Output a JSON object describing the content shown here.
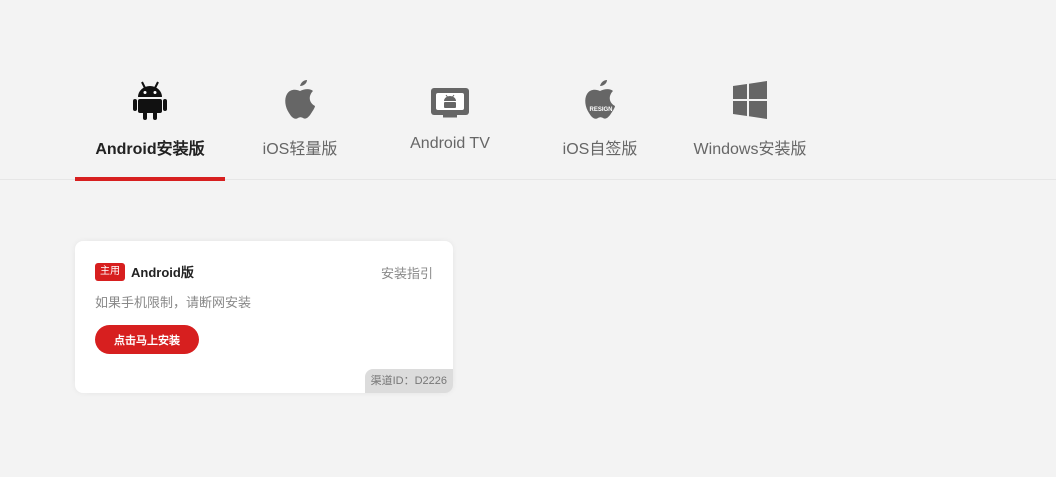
{
  "tabs": [
    {
      "label": "Android安装版",
      "icon": "android-icon",
      "active": true
    },
    {
      "label": "iOS轻量版",
      "icon": "apple-icon",
      "active": false
    },
    {
      "label": "Android TV",
      "icon": "android-tv-icon",
      "active": false
    },
    {
      "label": "iOS自签版",
      "icon": "apple-resign-icon",
      "active": false,
      "icon_text": "RESIGN"
    },
    {
      "label": "Windows安装版",
      "icon": "windows-icon",
      "active": false
    }
  ],
  "card": {
    "badge": "主用",
    "title": "Android版",
    "guide_link": "安装指引",
    "note": "如果手机限制，请断网安装",
    "install_button": "点击马上安装",
    "channel": "渠道ID：D2226"
  },
  "colors": {
    "accent": "#d71f1f",
    "background": "#f3f3f3",
    "icon": "#666666"
  }
}
